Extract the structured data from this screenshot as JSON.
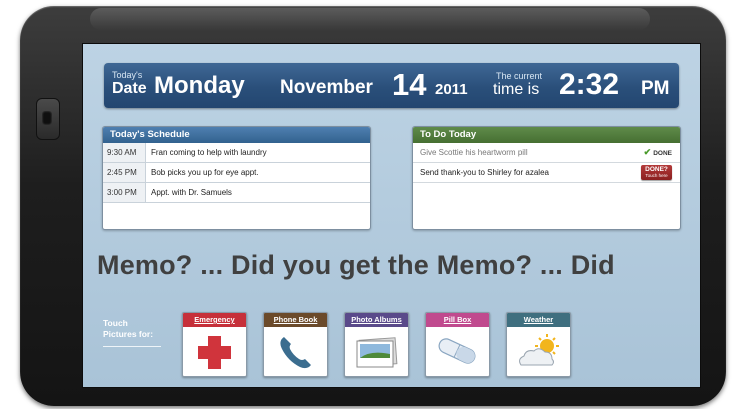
{
  "header": {
    "date_label_small": "Today's",
    "date_label_big": "Date",
    "weekday": "Monday",
    "month": "November",
    "day": "14",
    "year": "2011",
    "time_label_small": "The current",
    "time_label_big": "time is",
    "time": "2:32",
    "ampm": "PM"
  },
  "schedule": {
    "title": "Today's Schedule",
    "items": [
      {
        "time": "9:30 AM",
        "text": "Fran coming to help with laundry"
      },
      {
        "time": "2:45 PM",
        "text": "Bob picks you up for eye appt."
      },
      {
        "time": "3:00 PM",
        "text": "Appt. with Dr. Samuels"
      }
    ]
  },
  "todo": {
    "title": "To Do Today",
    "items": [
      {
        "text": "Give Scottie his heartworm pill",
        "status": "DONE"
      },
      {
        "text": "Send thank-you to Shirley for azalea",
        "button_label": "DONE?",
        "button_sub": "Touch here"
      }
    ]
  },
  "memo": "Memo? ... Did you get the Memo? ... Did",
  "touch": {
    "line1": "Touch",
    "line2": "Pictures for:"
  },
  "tiles": [
    {
      "label": "Emergency",
      "icon": "red-cross-icon",
      "color": "#c6303a"
    },
    {
      "label": "Phone Book",
      "icon": "phone-icon",
      "color": "#6b4a2a"
    },
    {
      "label": "Photo Albums",
      "icon": "photo-icon",
      "color": "#5a4a8a"
    },
    {
      "label": "Pill Box",
      "icon": "pill-icon",
      "color": "#c04a8e"
    },
    {
      "label": "Weather",
      "icon": "weather-icon",
      "color": "#3f6f7f"
    }
  ]
}
